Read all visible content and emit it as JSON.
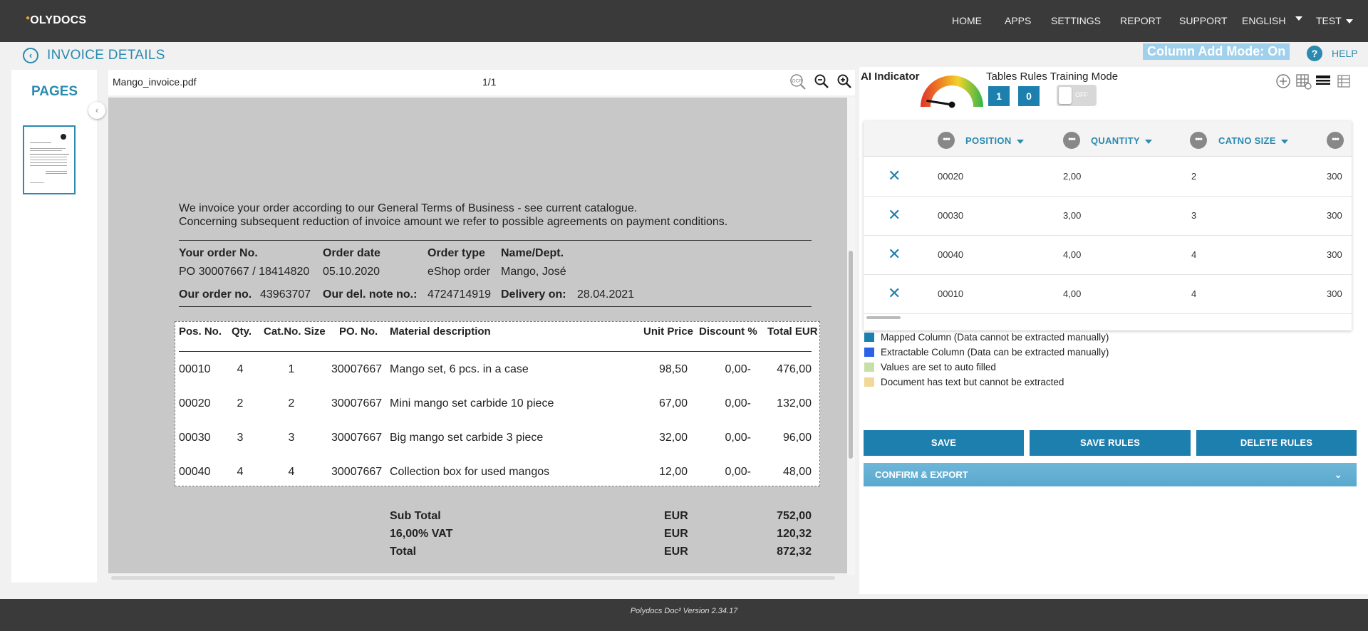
{
  "nav": {
    "logo_text": "OLYDOCS",
    "items": [
      "HOME",
      "APPS",
      "SETTINGS",
      "REPORT",
      "SUPPORT"
    ],
    "language": "ENGLISH",
    "user": "TEST"
  },
  "header": {
    "title": "INVOICE DETAILS",
    "column_add_mode": "Column Add Mode: On",
    "help": "HELP"
  },
  "pages": {
    "title": "PAGES"
  },
  "viewer": {
    "file_name": "Mango_invoice.pdf",
    "page_indicator": "1/1",
    "ocr_icon_label": "OCR"
  },
  "document": {
    "intro_line1": "We invoice your order according to our General Terms of Business - see current catalogue.",
    "intro_line2": "Concerning subsequent reduction of invoice amount we refer to possible agreements on payment conditions.",
    "order_headers": [
      "Your order No.",
      "Order date",
      "Order type",
      "Name/Dept."
    ],
    "order_values": [
      "PO 30007667 / 18414820",
      "05.10.2020",
      "eShop order",
      "Mango, José"
    ],
    "our_order_label": "Our order no.",
    "our_order_value": "43963707",
    "del_note_label": "Our del. note no.:",
    "del_note_value": "4724714919",
    "delivery_label": "Delivery on:",
    "delivery_value": "28.04.2021",
    "table_headers": [
      "Pos. No.",
      "Qty.",
      "Cat.No. Size",
      "PO. No.",
      "Material description",
      "Unit Price",
      "Discount %",
      "Total EUR"
    ],
    "table_rows": [
      [
        "00010",
        "4",
        "1",
        "30007667",
        "Mango set, 6 pcs. in a case",
        "98,50",
        "0,00-",
        "476,00"
      ],
      [
        "00020",
        "2",
        "2",
        "30007667",
        "Mini mango set carbide 10 piece",
        "67,00",
        "0,00-",
        "132,00"
      ],
      [
        "00030",
        "3",
        "3",
        "30007667",
        "Big mango set carbide 3 piece",
        "32,00",
        "0,00-",
        "96,00"
      ],
      [
        "00040",
        "4",
        "4",
        "30007667",
        "Collection box for used mangos",
        "12,00",
        "0,00-",
        "48,00"
      ]
    ],
    "totals": [
      [
        "Sub Total",
        "EUR",
        "752,00"
      ],
      [
        "16,00% VAT",
        "EUR",
        "120,32"
      ],
      [
        "Total",
        "EUR",
        "872,32"
      ]
    ]
  },
  "right": {
    "ai_indicator": "AI Indicator",
    "ai_level_fraction": 0.05,
    "tables_mode_label": "Tables Rules Training Mode",
    "count_a": "1",
    "count_b": "0",
    "toggle_label": "OFF",
    "grid": {
      "columns": [
        "POSITION",
        "QUANTITY",
        "CATNO SIZE"
      ],
      "rows": [
        [
          "00020",
          "2,00",
          "2",
          "300"
        ],
        [
          "00030",
          "3,00",
          "3",
          "300"
        ],
        [
          "00040",
          "4,00",
          "4",
          "300"
        ],
        [
          "00010",
          "4,00",
          "4",
          "300"
        ]
      ]
    },
    "legend": [
      {
        "label": "Mapped Column (Data cannot be extracted manually)",
        "color": "#1d7fae"
      },
      {
        "label": "Extractable Column (Data can be extracted manually)",
        "color": "#2a63e6"
      },
      {
        "label": "Values are set to auto filled",
        "color": "#c8e0a8"
      },
      {
        "label": "Document has text but cannot be extracted",
        "color": "#f0d89a"
      }
    ],
    "buttons": {
      "save": "SAVE",
      "save_rules": "SAVE RULES",
      "delete_rules": "DELETE RULES"
    },
    "accordion": "CONFIRM & EXPORT"
  },
  "footer": {
    "version": "Polydocs Doc² Version 2.34.17"
  },
  "colors": {
    "accent": "#2a8ab0",
    "button": "#1d7fae",
    "topbar": "#3a3a3a"
  }
}
